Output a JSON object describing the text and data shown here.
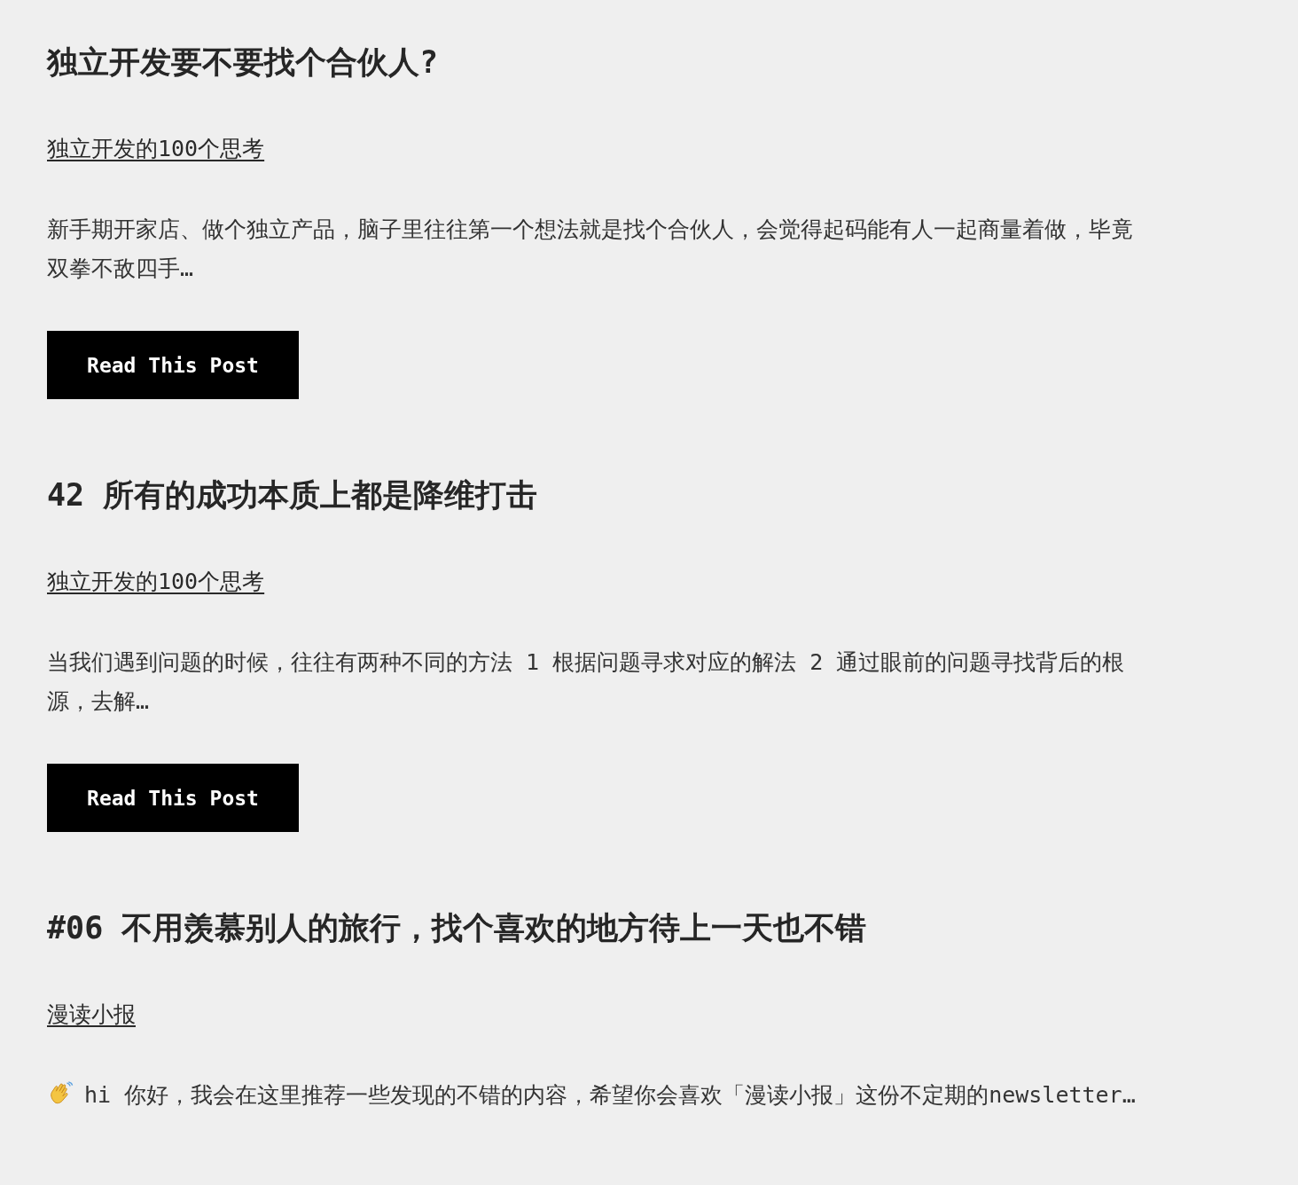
{
  "posts": [
    {
      "kind": "article",
      "title": "独立开发要不要找个合伙人?",
      "category": "独立开发的100个思考",
      "excerpt": "新手期开家店、做个独立产品，脑子里往往第一个想法就是找个合伙人，会觉得起码能有人一起商量着做，毕竟双拳不敌四手…",
      "button": "Read This Post"
    },
    {
      "kind": "article",
      "title": "42 所有的成功本质上都是降维打击",
      "category": "独立开发的100个思考",
      "excerpt": "当我们遇到问题的时候，往往有两种不同的方法 1 根据问题寻求对应的解法 2 通过眼前的问题寻找背后的根源，去解…",
      "button": "Read This Post"
    },
    {
      "kind": "greeting",
      "title": "#06 不用羡慕别人的旅行，找个喜欢的地方待上一天也不错",
      "category": "漫读小报",
      "excerpt": "hi 你好，我会在这里推荐一些发现的不错的内容，希望你会喜欢「漫读小报」这份不定期的newsletter…"
    }
  ]
}
